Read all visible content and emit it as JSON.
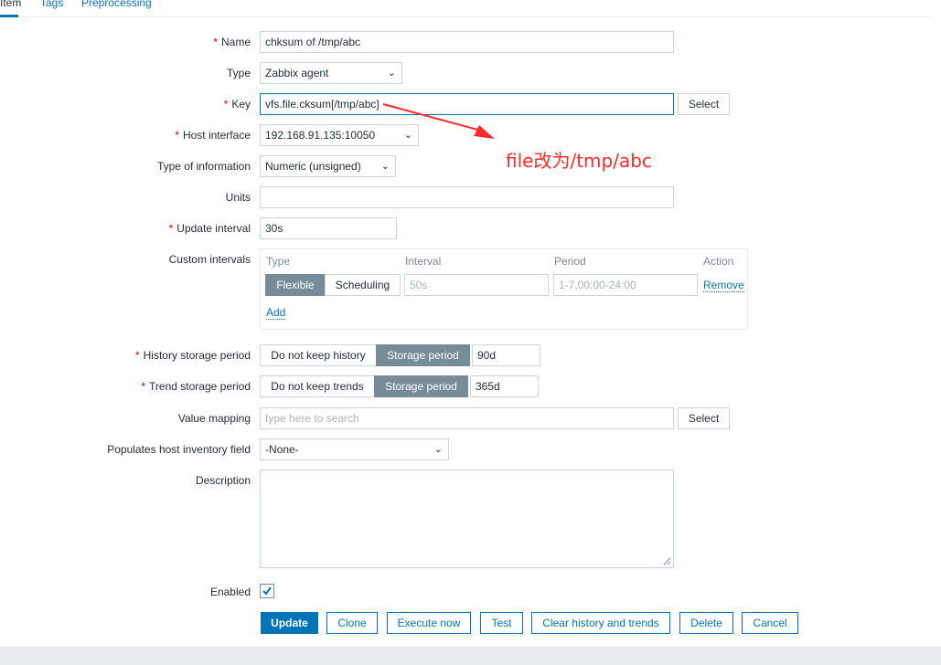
{
  "tabs": [
    {
      "label": "Item",
      "active": true
    },
    {
      "label": "Tags",
      "active": false
    },
    {
      "label": "Preprocessing",
      "active": false
    }
  ],
  "form": {
    "name": {
      "label": "Name",
      "value": "chksum of /tmp/abc"
    },
    "type": {
      "label": "Type",
      "value": "Zabbix agent"
    },
    "key": {
      "label": "Key",
      "value": "vfs.file.cksum[/tmp/abc]",
      "select_label": "Select"
    },
    "host_interface": {
      "label": "Host interface",
      "value": "192.168.91.135:10050"
    },
    "type_of_information": {
      "label": "Type of information",
      "value": "Numeric (unsigned)"
    },
    "units": {
      "label": "Units",
      "value": ""
    },
    "update_interval": {
      "label": "Update interval",
      "value": "30s"
    },
    "custom_intervals": {
      "label": "Custom intervals",
      "headers": {
        "type": "Type",
        "interval": "Interval",
        "period": "Period",
        "action": "Action"
      },
      "row": {
        "flexible": "Flexible",
        "scheduling": "Scheduling",
        "interval_placeholder": "50s",
        "period_placeholder": "1-7,00:00-24:00",
        "remove": "Remove"
      },
      "add": "Add"
    },
    "history": {
      "label": "History storage period",
      "option_off": "Do not keep history",
      "option_on": "Storage period",
      "value": "90d"
    },
    "trend": {
      "label": "Trend storage period",
      "option_off": "Do not keep trends",
      "option_on": "Storage period",
      "value": "365d"
    },
    "value_mapping": {
      "label": "Value mapping",
      "placeholder": "type here to search",
      "select_label": "Select"
    },
    "inventory": {
      "label": "Populates host inventory field",
      "value": "-None-"
    },
    "description": {
      "label": "Description",
      "value": ""
    },
    "enabled": {
      "label": "Enabled",
      "checked": true
    }
  },
  "actions": {
    "update": "Update",
    "clone": "Clone",
    "execute_now": "Execute now",
    "test": "Test",
    "clear_history": "Clear history and trends",
    "delete": "Delete",
    "cancel": "Cancel"
  },
  "annotation": {
    "text": "file改为/tmp/abc",
    "color": "#ff2a2a"
  },
  "colors": {
    "accent": "#0275b8",
    "required": "#d40000",
    "segment_on": "#768d99"
  }
}
